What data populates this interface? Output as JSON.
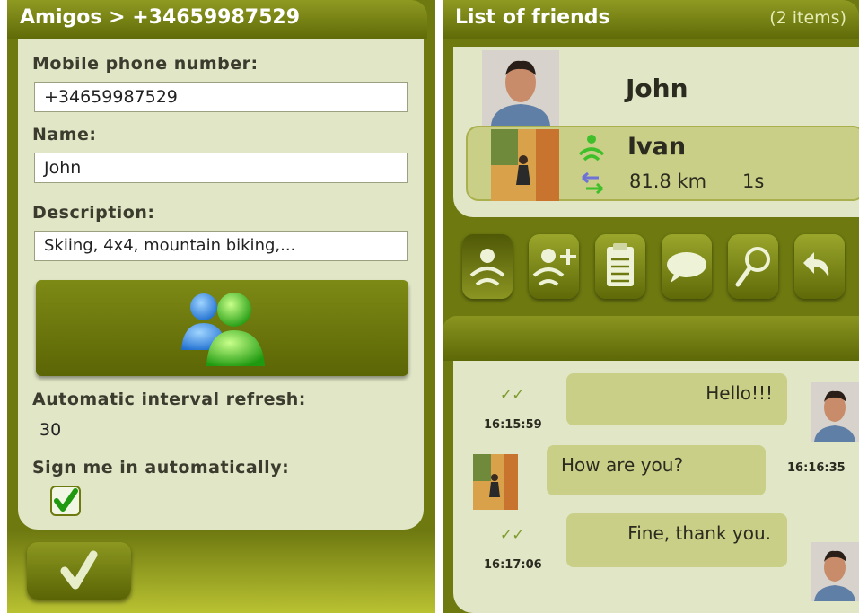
{
  "left_screen": {
    "title": "Amigos > +34659987529",
    "phone_label": "Mobile phone number:",
    "phone_value": "+34659987529",
    "name_label": "Name:",
    "name_value": "John",
    "description_label": "Description:",
    "description_value": "Skiing, 4x4, mountain biking,...",
    "messenger_icon": "messenger-people-icon",
    "refresh_label": "Automatic interval refresh:",
    "refresh_value": "30",
    "signin_label": "Sign me in automatically:",
    "signin_checked": true,
    "confirm_icon": "checkmark-icon"
  },
  "right_screen": {
    "title": "List of friends",
    "item_count": "(2 items)",
    "friends": [
      {
        "name": "John"
      },
      {
        "name": "Ivan",
        "distance": "81.8 km",
        "last_seen": "1s",
        "selected": true
      }
    ],
    "toolbar_icons": [
      "friend-signal-icon",
      "add-friend-icon",
      "clipboard-icon",
      "chat-bubble-icon",
      "search-icon",
      "back-icon"
    ],
    "messages": [
      {
        "text": "Hello!!!",
        "time": "16:15:59",
        "direction": "outgoing"
      },
      {
        "text": "How are you?",
        "time": "16:16:35",
        "direction": "incoming"
      },
      {
        "text": "Fine, thank you.",
        "time": "16:17:06",
        "direction": "outgoing"
      }
    ],
    "read_tick": "✓✓"
  }
}
